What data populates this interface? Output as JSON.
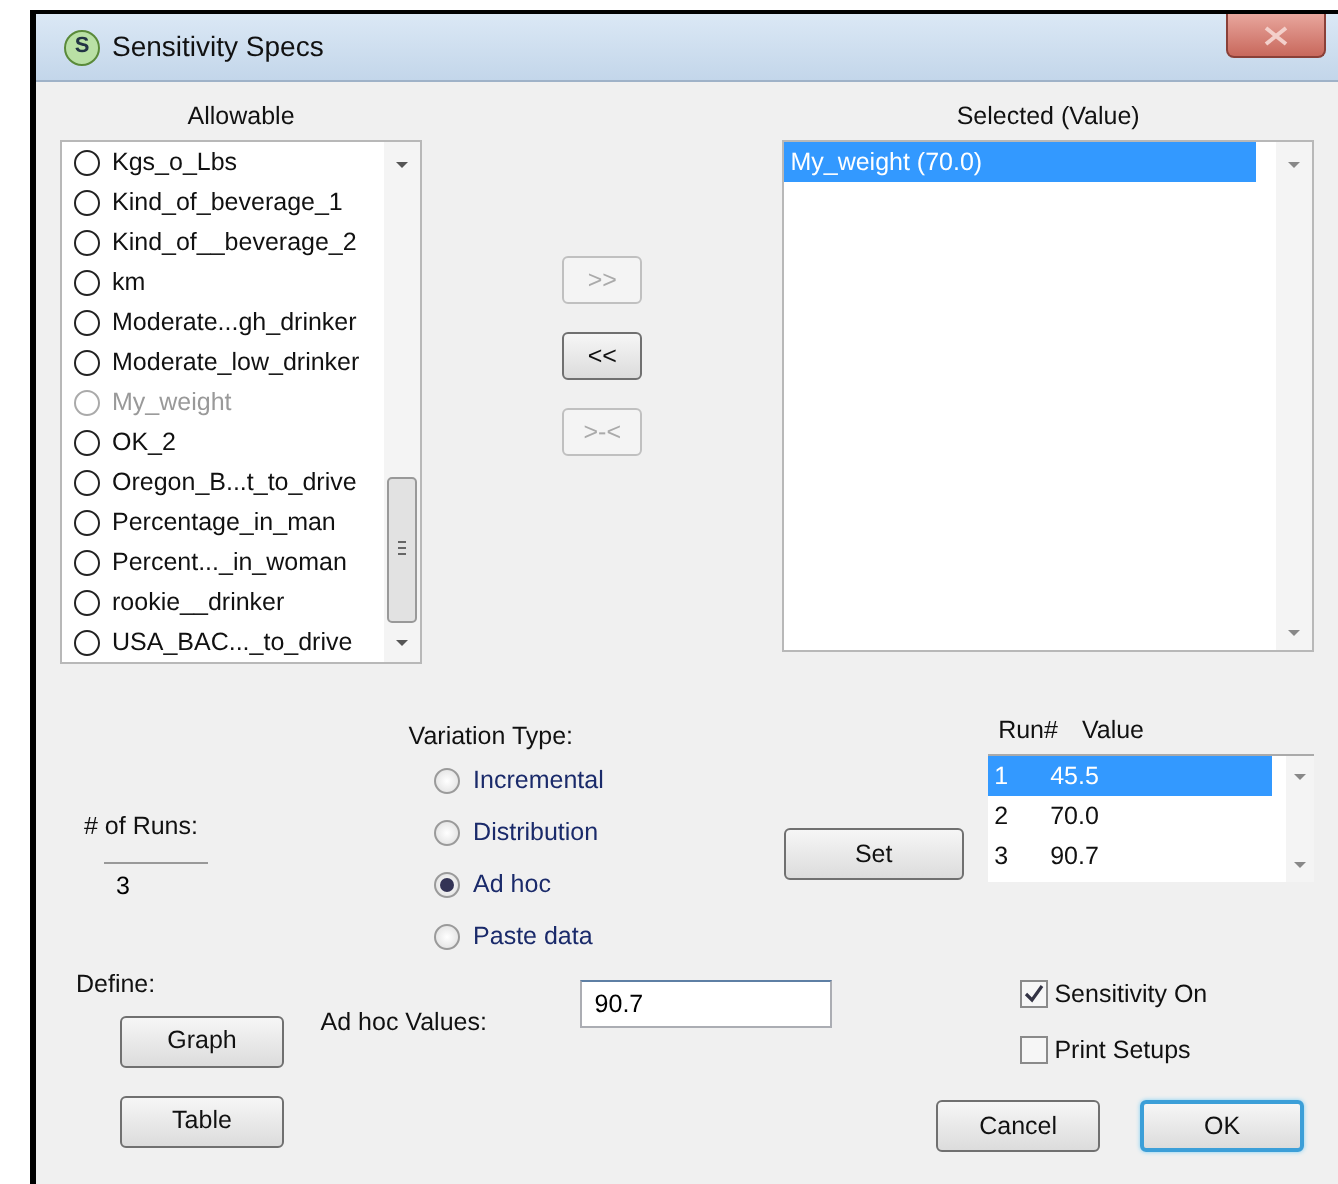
{
  "window": {
    "title": "Sensitivity Specs",
    "icon_letter": "S"
  },
  "allowable": {
    "heading": "Allowable",
    "items": [
      {
        "label": "Kgs_o_Lbs",
        "disabled": false
      },
      {
        "label": "Kind_of_beverage_1",
        "disabled": false
      },
      {
        "label": "Kind_of__beverage_2",
        "disabled": false
      },
      {
        "label": "km",
        "disabled": false
      },
      {
        "label": "Moderate...gh_drinker",
        "disabled": false
      },
      {
        "label": "Moderate_low_drinker",
        "disabled": false
      },
      {
        "label": "My_weight",
        "disabled": true
      },
      {
        "label": "OK_2",
        "disabled": false
      },
      {
        "label": "Oregon_B...t_to_drive",
        "disabled": false
      },
      {
        "label": "Percentage_in_man",
        "disabled": false
      },
      {
        "label": "Percent..._in_woman",
        "disabled": false
      },
      {
        "label": "rookie__drinker",
        "disabled": false
      },
      {
        "label": "USA_BAC..._to_drive",
        "disabled": false
      }
    ]
  },
  "transfer_buttons": [
    {
      "label": ">>",
      "disabled": true
    },
    {
      "label": "<<",
      "disabled": false
    },
    {
      "label": ">-<",
      "disabled": true
    }
  ],
  "selected": {
    "heading": "Selected (Value)",
    "items": [
      {
        "label": "My_weight (70.0)",
        "selected": true
      }
    ]
  },
  "runs": {
    "label": "# of Runs:",
    "value": "3"
  },
  "variation_type": {
    "label": "Variation Type:",
    "options": [
      {
        "label": "Incremental",
        "selected": false
      },
      {
        "label": "Distribution",
        "selected": false
      },
      {
        "label": "Ad hoc",
        "selected": true
      },
      {
        "label": "Paste data",
        "selected": false
      }
    ]
  },
  "set_button": "Set",
  "run_table": {
    "columns": [
      "Run#",
      "Value"
    ],
    "rows": [
      {
        "cells": [
          "1",
          "45.5"
        ],
        "selected": true
      },
      {
        "cells": [
          "2",
          "70.0"
        ],
        "selected": false
      },
      {
        "cells": [
          "3",
          "90.7"
        ],
        "selected": false
      }
    ]
  },
  "define_label": "Define:",
  "define_buttons": [
    "Graph",
    "Table"
  ],
  "ad_hoc": {
    "label": "Ad hoc Values:",
    "value": "90.7"
  },
  "checkboxes": [
    {
      "label": "Sensitivity On",
      "checked": true
    },
    {
      "label": "Print Setups",
      "checked": false
    }
  ],
  "buttons": [
    {
      "label": "Cancel",
      "default": false
    },
    {
      "label": "OK",
      "default": true
    }
  ]
}
